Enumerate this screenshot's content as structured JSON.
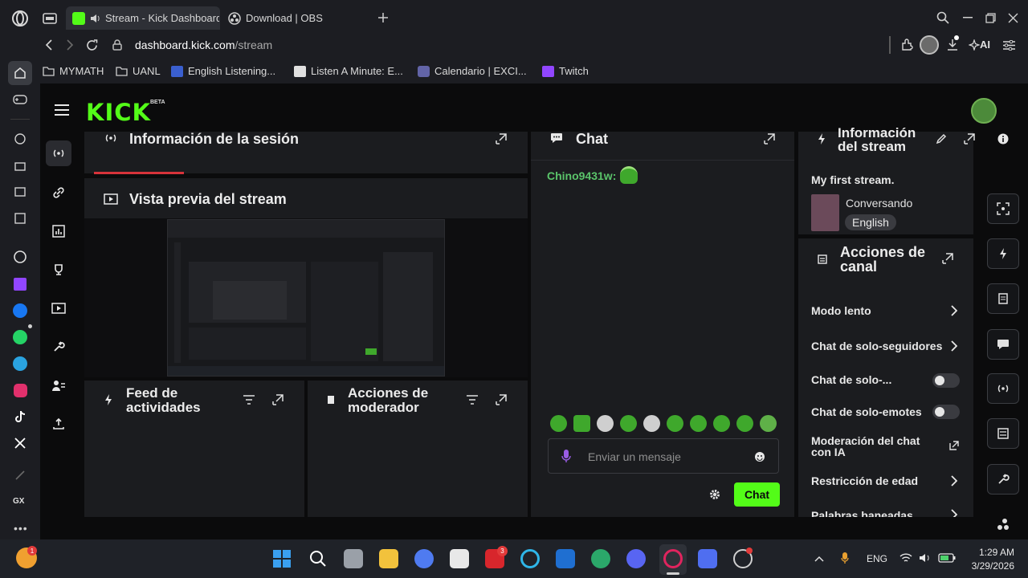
{
  "browser": {
    "tabs": [
      {
        "label": "Stream - Kick Dashboard",
        "active": true
      },
      {
        "label": "Download | OBS",
        "active": false
      }
    ],
    "url": {
      "host": "dashboard.kick.com",
      "path": "/stream"
    },
    "ai_label": "AI",
    "bookmarks": [
      "MYMATH",
      "UANL",
      "English Listening...",
      "Listen A Minute: E...",
      "Calendario | EXCI...",
      "Twitch"
    ],
    "sidebar_bottom_label": "GX"
  },
  "kick": {
    "logo": "KICK",
    "beta": "BETA",
    "panels": {
      "session": {
        "title": "Información de la sesión"
      },
      "preview": {
        "title": "Vista previa del stream"
      },
      "activity": {
        "title": "Feed de actividades"
      },
      "moderator": {
        "title": "Acciones de moderador"
      },
      "chat": {
        "title": "Chat",
        "messages": [
          {
            "user": "Chino9431w:"
          }
        ],
        "input_placeholder": "Enviar un mensaje",
        "send_label": "Chat"
      },
      "stream_info": {
        "title": "Información del stream",
        "stream_title": "My first stream.",
        "category": "Conversando",
        "language": "English"
      },
      "channel_actions": {
        "title": "Acciones de canal",
        "rows": [
          {
            "label": "Modo lento",
            "control": "chevron"
          },
          {
            "label": "Chat de solo-seguidores",
            "control": "chevron"
          },
          {
            "label": "Chat de solo-...",
            "control": "toggle",
            "on": false
          },
          {
            "label": "Chat de solo-emotes",
            "control": "toggle",
            "on": false
          },
          {
            "label": "Moderación del chat con IA",
            "control": "external"
          },
          {
            "label": "Restricción de edad",
            "control": "chevron"
          },
          {
            "label": "Palabras baneadas",
            "control": "chevron"
          }
        ]
      }
    },
    "accent": "#53fc18"
  },
  "taskbar": {
    "language": "ENG",
    "time": "1:29 AM",
    "date": "3/29/2026",
    "badges": {
      "l_app": "3",
      "opera_gx": "1"
    }
  }
}
